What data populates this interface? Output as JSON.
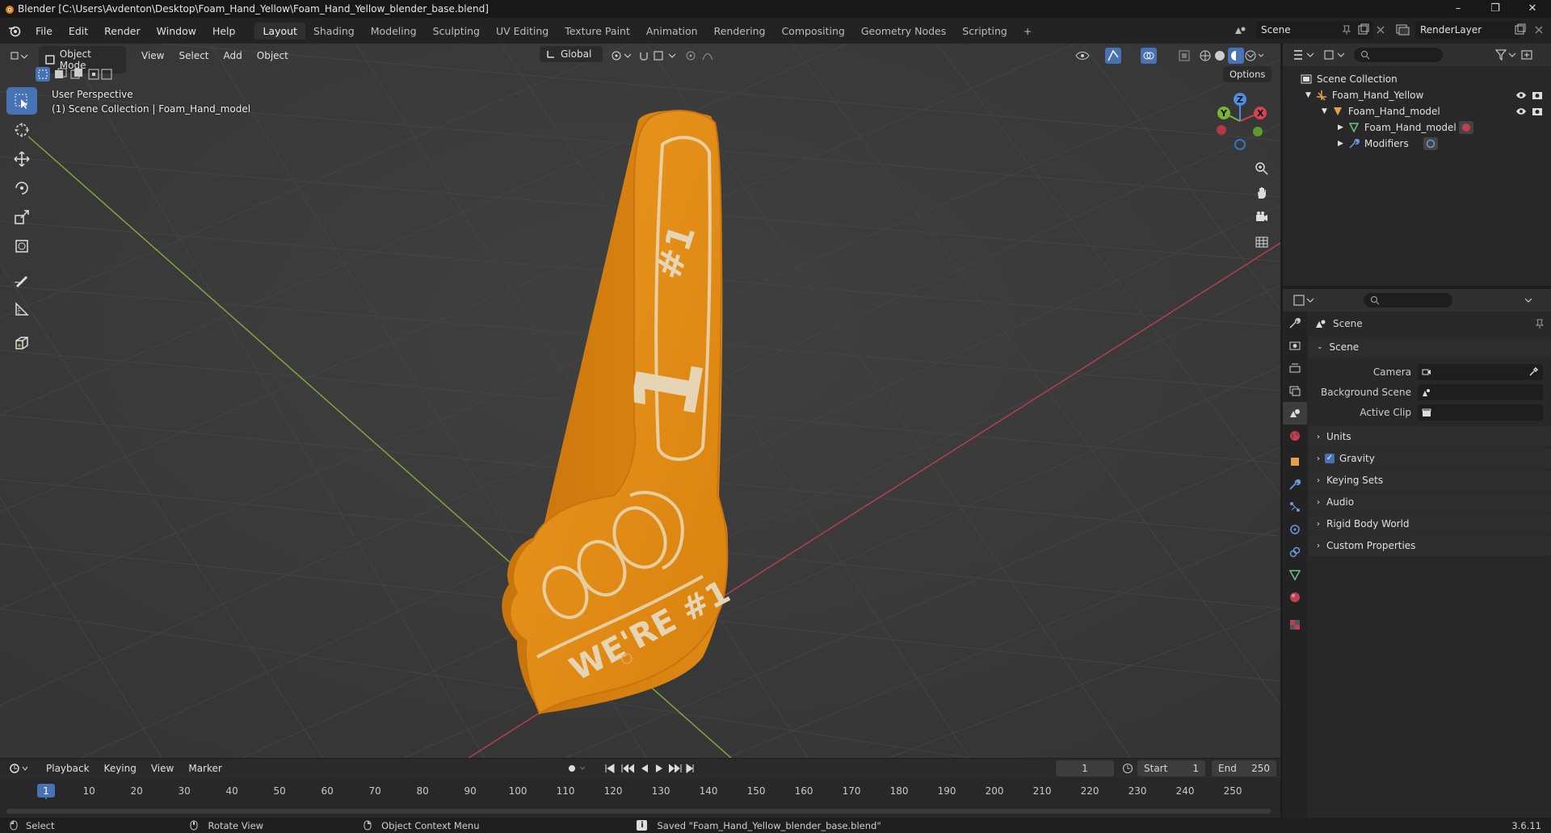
{
  "window": {
    "title": "Blender [C:\\Users\\Avdenton\\Desktop\\Foam_Hand_Yellow\\Foam_Hand_Yellow_blender_base.blend]",
    "controls": [
      "–",
      "❐",
      "✕"
    ]
  },
  "topbar": {
    "menus": [
      "File",
      "Edit",
      "Render",
      "Window",
      "Help"
    ],
    "workspaces": [
      "Layout",
      "Shading",
      "Modeling",
      "Sculpting",
      "UV Editing",
      "Texture Paint",
      "Animation",
      "Rendering",
      "Compositing",
      "Geometry Nodes",
      "Scripting"
    ],
    "active_workspace": "Layout",
    "add_tab": "+",
    "scene": "Scene",
    "render_layer": "RenderLayer"
  },
  "viewport_header": {
    "mode": "Object Mode",
    "menus": [
      "View",
      "Select",
      "Add",
      "Object"
    ],
    "transform_orientation": "Global",
    "options_label": "Options"
  },
  "viewport": {
    "perspective": "User Perspective",
    "collection_info": "(1) Scene Collection | Foam_Hand_model",
    "gizmo_axes": [
      "Z",
      "Y",
      "X"
    ],
    "model_text": [
      "#1",
      "WE'RE #1"
    ]
  },
  "outliner": {
    "root": "Scene Collection",
    "items": [
      {
        "label": "Foam_Hand_Yellow",
        "depth": 1
      },
      {
        "label": "Foam_Hand_model",
        "depth": 2
      },
      {
        "label": "Foam_Hand_model",
        "depth": 3
      },
      {
        "label": "Modifiers",
        "depth": 3
      }
    ]
  },
  "properties": {
    "context_title": "Scene",
    "scene_panel": {
      "title": "Scene",
      "fields": [
        {
          "label": "Camera"
        },
        {
          "label": "Background Scene"
        },
        {
          "label": "Active Clip"
        }
      ]
    },
    "collapsed_panels": [
      "Units",
      "Gravity",
      "Keying Sets",
      "Audio",
      "Rigid Body World",
      "Custom Properties"
    ],
    "gravity_checked": true
  },
  "timeline": {
    "menus": [
      "Playback",
      "Keying",
      "View",
      "Marker"
    ],
    "current_frame": "1",
    "start_label": "Start",
    "start": "1",
    "end_label": "End",
    "end": "250",
    "ticks": [
      "1",
      "10",
      "20",
      "30",
      "40",
      "50",
      "60",
      "70",
      "80",
      "90",
      "100",
      "110",
      "120",
      "130",
      "140",
      "150",
      "160",
      "170",
      "180",
      "190",
      "200",
      "210",
      "220",
      "230",
      "240",
      "250"
    ]
  },
  "statusbar": {
    "hints": [
      "Select",
      "Rotate View",
      "Object Context Menu"
    ],
    "message": "Saved \"Foam_Hand_Yellow_blender_base.blend\"",
    "version": "3.6.11"
  },
  "colors": {
    "accent": "#4772b3",
    "foam": "#e08a1a",
    "x_axis": "#d4434f",
    "y_axis": "#7ab33c",
    "z_axis": "#4a8fe0"
  }
}
